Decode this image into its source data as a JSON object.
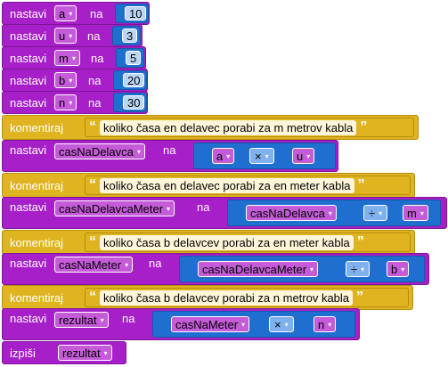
{
  "labels": {
    "set": "nastavi",
    "to": "na",
    "comment": "komentiraj",
    "print": "izpiši",
    "quote_open": "“",
    "quote_close": "”",
    "dropdown": "▾"
  },
  "assign_simple": [
    {
      "var": "a",
      "value": "10"
    },
    {
      "var": "u",
      "value": "3"
    },
    {
      "var": "m",
      "value": "5"
    },
    {
      "var": "b",
      "value": "20"
    },
    {
      "var": "n",
      "value": "30"
    }
  ],
  "comments": [
    "koliko časa en delavec porabi za m metrov kabla",
    "koliko časa en delavec porabi za en meter kabla",
    "koliko časa b delavcev porabi za en meter kabla",
    "koliko časa b delavcev porabi za n metrov kabla"
  ],
  "assign_math": [
    {
      "var": "casNaDelavca",
      "left": "a",
      "op": "×",
      "right": "u"
    },
    {
      "var": "casNaDelavcaMeter",
      "left": "casNaDelavca",
      "op": "÷",
      "right": "m"
    },
    {
      "var": "casNaMeter",
      "left": "casNaDelavcaMeter",
      "op": "÷",
      "right": "b"
    },
    {
      "var": "rezultat",
      "left": "casNaMeter",
      "op": "×",
      "right": "n"
    }
  ],
  "print_var": "rezultat",
  "colors": {
    "variables_block": "#a61fc9",
    "math_block": "#1f6fd0",
    "comment_block": "#e0b320",
    "variable_chip": "#c55bd8"
  }
}
